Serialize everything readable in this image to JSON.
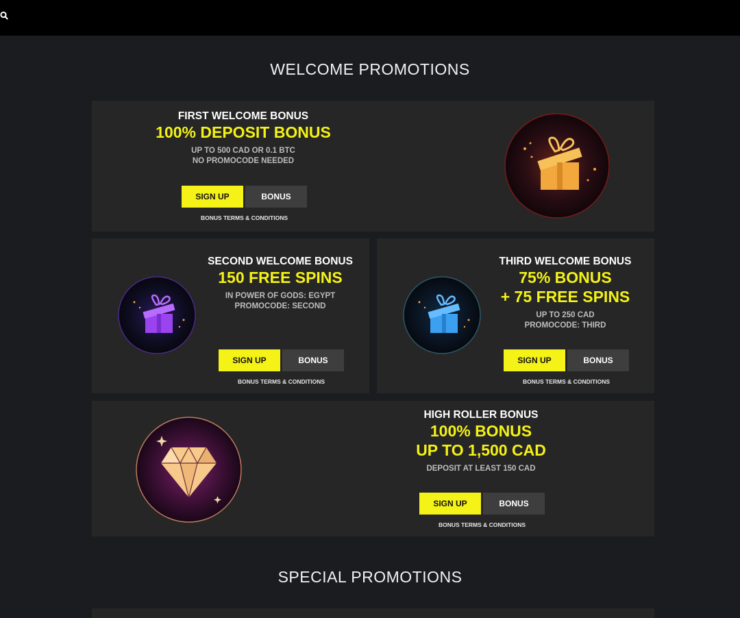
{
  "header": {
    "search_icon": "search-icon"
  },
  "welcome": {
    "title": "WELCOME PROMOTIONS",
    "cards": [
      {
        "label": "FIRST WELCOME BONUS",
        "amount_lines": [
          "100% DEPOSIT BONUS"
        ],
        "details": [
          "UP TO 500 CAD OR 0.1 BTC",
          "NO PROMOCODE NEEDED"
        ],
        "signup_label": "SIGN UP",
        "bonus_label": "BONUS",
        "terms_label": "BONUS TERMS & CONDITIONS",
        "icon": "gift-icon",
        "icon_color": "#f5b942"
      },
      {
        "label": "SECOND WELCOME BONUS",
        "amount_lines": [
          "150 FREE SPINS"
        ],
        "details": [
          "IN POWER OF GODS: EGYPT",
          "PROMOCODE: SECOND"
        ],
        "signup_label": "SIGN UP",
        "bonus_label": "BONUS",
        "terms_label": "BONUS TERMS & CONDITIONS",
        "icon": "gift-icon",
        "icon_color": "#a24cf5"
      },
      {
        "label": "THIRD WELCOME BONUS",
        "amount_lines": [
          "75% BONUS",
          "+ 75 FREE SPINS"
        ],
        "details": [
          "UP TO 250 CAD",
          "PROMOCODE: THIRD"
        ],
        "signup_label": "SIGN UP",
        "bonus_label": "BONUS",
        "terms_label": "BONUS TERMS & CONDITIONS",
        "icon": "gift-icon",
        "icon_color": "#3fa9f5"
      },
      {
        "label": "HIGH ROLLER BONUS",
        "amount_lines": [
          "100% BONUS",
          "UP TO 1,500 CAD"
        ],
        "details": [
          "DEPOSIT AT LEAST 150 CAD"
        ],
        "signup_label": "SIGN UP",
        "bonus_label": "BONUS",
        "terms_label": "BONUS TERMS & CONDITIONS",
        "icon": "diamond-icon",
        "icon_color": "#f7c98a"
      }
    ]
  },
  "special": {
    "title": "SPECIAL PROMOTIONS"
  },
  "colors": {
    "accent": "#f4f216",
    "card_bg": "#262626",
    "page_bg": "#1a1c20"
  }
}
